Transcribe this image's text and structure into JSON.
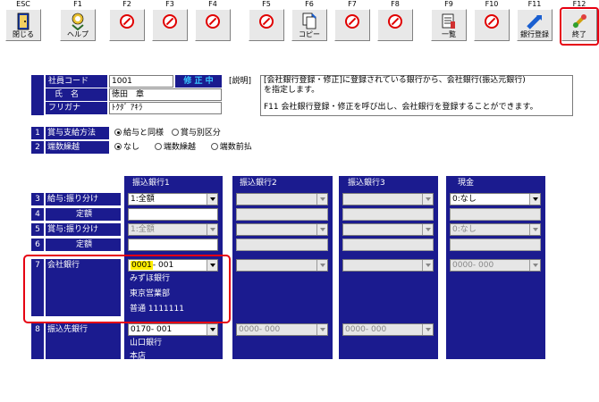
{
  "toolbar": {
    "keys": [
      "ESC",
      "F1",
      "F2",
      "F3",
      "F4",
      "F5",
      "F6",
      "F7",
      "F8",
      "F9",
      "F10",
      "F11",
      "F12"
    ],
    "buttons": [
      {
        "key": "ESC",
        "icon": "exit-door-icon",
        "label": "閉じる"
      },
      {
        "key": "F1",
        "icon": "help-icon",
        "label": "ヘルプ"
      },
      {
        "key": "F2",
        "icon": "disabled-icon",
        "label": ""
      },
      {
        "key": "F3",
        "icon": "disabled-icon",
        "label": ""
      },
      {
        "key": "F4",
        "icon": "disabled-icon",
        "label": ""
      },
      {
        "key": "F5",
        "icon": "disabled-icon",
        "label": ""
      },
      {
        "key": "F6",
        "icon": "copy-icon",
        "label": "コピー"
      },
      {
        "key": "F7",
        "icon": "disabled-icon",
        "label": ""
      },
      {
        "key": "F8",
        "icon": "disabled-icon",
        "label": ""
      },
      {
        "key": "F9",
        "icon": "list-icon",
        "label": "一覧"
      },
      {
        "key": "F10",
        "icon": "disabled-icon",
        "label": ""
      },
      {
        "key": "F11",
        "icon": "bank-register-icon",
        "label": "銀行登録"
      },
      {
        "key": "F12",
        "icon": "finish-icon",
        "label": "終了"
      }
    ]
  },
  "employee": {
    "code_label": "社員コード",
    "code_value": "1001",
    "mode_badge": "修 正 中",
    "name_label": "氏　名",
    "name_value": "徳田　章",
    "kana_label": "フリガナ",
    "kana_value": "ﾄｸﾀﾞ ｱｷﾗ"
  },
  "description": {
    "label": "[説明]",
    "line1": "[会社銀行登録・修正]に登録されている銀行から、会社銀行(振込元銀行)",
    "line2": "を指定します。",
    "line3": "F11 会社銀行登録・修正を呼び出し、会社銀行を登録することができます。"
  },
  "options": [
    {
      "num": "1",
      "label": "賞与支給方法",
      "choices": [
        "給与と同様",
        "賞与別区分"
      ],
      "selected": 0
    },
    {
      "num": "2",
      "label": "端数繰越",
      "choices": [
        "なし",
        "端数繰越",
        "端数前払"
      ],
      "selected": 0
    }
  ],
  "columns": [
    "振込銀行1",
    "振込銀行2",
    "振込銀行3",
    "現金"
  ],
  "rows": [
    {
      "num": "3",
      "label": "給与:振り分け"
    },
    {
      "num": "4",
      "label": "定額"
    },
    {
      "num": "5",
      "label": "賞与:振り分け"
    },
    {
      "num": "6",
      "label": "定額"
    },
    {
      "num": "7",
      "label": "会社銀行"
    },
    {
      "num": "8",
      "label": "振込先銀行"
    }
  ],
  "bank1": {
    "salary_split": "1:全額",
    "bonus_split": "1:全額",
    "company_bank_code_hl": "0001",
    "company_bank_code_rest": "- 001",
    "company_bank_name": "みずほ銀行",
    "company_branch": "東京営業部",
    "company_account": "普通 1111111",
    "dest_bank_code": "0170- 001",
    "dest_bank_name": "山口銀行",
    "dest_branch": "本店"
  },
  "bank2": {
    "dest_bank_code": "0000- 000"
  },
  "bank3": {
    "dest_bank_code": "0000- 000"
  },
  "cash": {
    "salary_split": "0:なし",
    "bonus_split": "0:なし",
    "company_bank_code": "0000- 000"
  }
}
